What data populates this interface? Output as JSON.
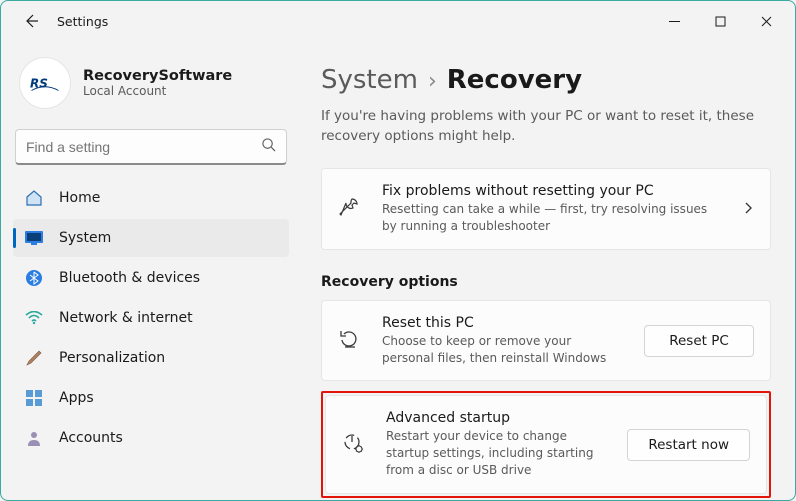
{
  "window": {
    "title": "Settings"
  },
  "profile": {
    "name": "RecoverySoftware",
    "account_type": "Local Account"
  },
  "search": {
    "placeholder": "Find a setting"
  },
  "sidebar": {
    "items": [
      {
        "label": "Home"
      },
      {
        "label": "System"
      },
      {
        "label": "Bluetooth & devices"
      },
      {
        "label": "Network & internet"
      },
      {
        "label": "Personalization"
      },
      {
        "label": "Apps"
      },
      {
        "label": "Accounts"
      }
    ],
    "active_index": 1
  },
  "breadcrumb": {
    "parent": "System",
    "current": "Recovery"
  },
  "header_description": "If you're having problems with your PC or want to reset it, these recovery options might help.",
  "fix_card": {
    "title": "Fix problems without resetting your PC",
    "subtitle": "Resetting can take a while — first, try resolving issues by running a troubleshooter"
  },
  "recovery_section": {
    "heading": "Recovery options",
    "reset": {
      "title": "Reset this PC",
      "subtitle": "Choose to keep or remove your personal files, then reinstall Windows",
      "button": "Reset PC"
    },
    "advanced": {
      "title": "Advanced startup",
      "subtitle": "Restart your device to change startup settings, including starting from a disc or USB drive",
      "button": "Restart now"
    }
  }
}
